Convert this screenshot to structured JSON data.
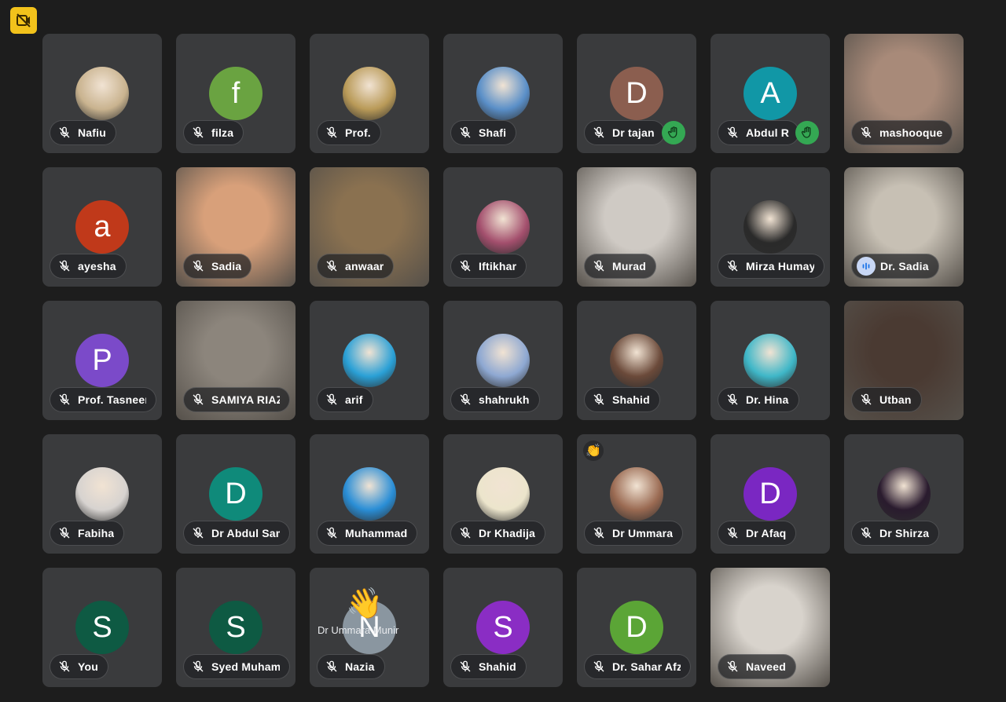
{
  "toolbar": {
    "corner_icon": "no-video-icon"
  },
  "tooltip": "Dr Ummara Munir",
  "participants": [
    {
      "name": "Nafiu",
      "avatar": "photo",
      "color": "#c9b38f",
      "muted": true
    },
    {
      "name": "filza",
      "avatar": "letter",
      "letter": "f",
      "color": "#6aa341",
      "muted": true
    },
    {
      "name": "Prof.",
      "avatar": "photo",
      "color": "#b99a58",
      "muted": true
    },
    {
      "name": "Shafi",
      "avatar": "photo",
      "color": "#5a8fc8",
      "muted": true
    },
    {
      "name": "Dr tajan",
      "avatar": "letter",
      "letter": "D",
      "color": "#8b5e4f",
      "muted": true,
      "hand": true
    },
    {
      "name": "Abdul R",
      "avatar": "letter",
      "letter": "A",
      "color": "#1197a6",
      "muted": true,
      "hand": true
    },
    {
      "name": "mashooque",
      "avatar": "video",
      "color": "#a88a79",
      "muted": true
    },
    {
      "name": "ayesha",
      "avatar": "letter",
      "letter": "a",
      "color": "#c0391a",
      "muted": true
    },
    {
      "name": "Sadia",
      "avatar": "video",
      "color": "#d8a07a",
      "muted": true
    },
    {
      "name": "anwaar",
      "avatar": "video",
      "color": "#8a7150",
      "muted": true
    },
    {
      "name": "Iftikhar",
      "avatar": "photo",
      "color": "#a34f6d",
      "muted": true
    },
    {
      "name": "Murad",
      "avatar": "video",
      "color": "#cfcac4",
      "muted": true
    },
    {
      "name": "Mirza Humay",
      "avatar": "photo",
      "color": "#2a2a2a",
      "muted": true
    },
    {
      "name": "Dr. Sadia",
      "avatar": "video",
      "color": "#c7c0b4",
      "muted": false,
      "speaking": true
    },
    {
      "name": "Prof. Tasneem",
      "avatar": "letter",
      "letter": "P",
      "color": "#7b4ac9",
      "muted": true
    },
    {
      "name": "SAMIYA RIAZ",
      "avatar": "video",
      "color": "#8c857c",
      "muted": true
    },
    {
      "name": "arif",
      "avatar": "photo",
      "color": "#2aa0d6",
      "muted": true
    },
    {
      "name": "shahrukh",
      "avatar": "photo",
      "color": "#8ea8d2",
      "muted": true
    },
    {
      "name": "Shahid",
      "avatar": "photo",
      "color": "#6b4a3a",
      "muted": true
    },
    {
      "name": "Dr. Hina",
      "avatar": "photo",
      "color": "#3fb7c8",
      "muted": true
    },
    {
      "name": "Utban",
      "avatar": "video",
      "color": "#4a3a32",
      "muted": true
    },
    {
      "name": "Fabiha",
      "avatar": "photo",
      "color": "#d7d3d0",
      "muted": true
    },
    {
      "name": "Dr Abdul Samad",
      "avatar": "letter",
      "letter": "D",
      "color": "#0f8a7a",
      "muted": true
    },
    {
      "name": "Muhammad",
      "avatar": "photo",
      "color": "#2a8ed6",
      "muted": true
    },
    {
      "name": "Dr Khadija",
      "avatar": "photo",
      "color": "#ece5cc",
      "muted": true
    },
    {
      "name": "Dr Ummara",
      "avatar": "photo",
      "color": "#9a6a52",
      "muted": true,
      "clap": true
    },
    {
      "name": "Dr Afaq",
      "avatar": "letter",
      "letter": "D",
      "color": "#7a27c2",
      "muted": true
    },
    {
      "name": "Dr Shirza",
      "avatar": "photo",
      "color": "#2a1b2e",
      "muted": true
    },
    {
      "name": "You",
      "avatar": "letter",
      "letter": "S",
      "color": "#0e5a43",
      "muted": true
    },
    {
      "name": "Syed Muhammad",
      "avatar": "letter",
      "letter": "S",
      "color": "#0e5a43",
      "muted": true
    },
    {
      "name": "Nazia",
      "avatar": "letter",
      "letter": "N",
      "color": "#8a96a0",
      "muted": true,
      "bigwave": true
    },
    {
      "name": "Shahid",
      "avatar": "letter",
      "letter": "S",
      "color": "#8a2dc4",
      "muted": true
    },
    {
      "name": "Dr. Sahar Afzal",
      "avatar": "letter",
      "letter": "D",
      "color": "#5ba536",
      "muted": true
    },
    {
      "name": "Naveed",
      "avatar": "video",
      "color": "#d8d3cc",
      "muted": true
    }
  ]
}
